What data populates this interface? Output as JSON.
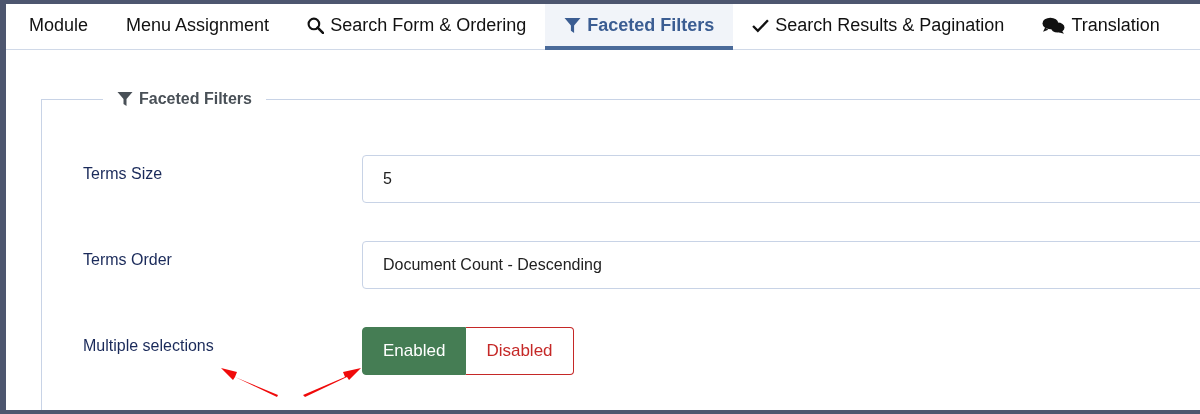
{
  "tabs": [
    {
      "label": "Module",
      "selected": false
    },
    {
      "label": "Menu Assignment",
      "selected": false
    },
    {
      "label": "Search Form & Ordering",
      "kind": "search",
      "selected": false
    },
    {
      "label": "Faceted Filters",
      "kind": "filter",
      "selected": true
    },
    {
      "label": "Search Results & Pagination",
      "kind": "check",
      "selected": false
    },
    {
      "label": "Translation",
      "kind": "chat",
      "selected": false
    }
  ],
  "fieldset": {
    "legend": "Faceted Filters",
    "fields": [
      {
        "kind": "input",
        "label": "Terms Size",
        "value": "5"
      },
      {
        "kind": "select",
        "label": "Terms Order",
        "value": "Document Count - Descending"
      },
      {
        "kind": "toggle",
        "label": "Multiple selections",
        "options": [
          {
            "label": "Enabled",
            "selected": true
          },
          {
            "label": "Disabled",
            "selected": false
          }
        ],
        "annotated": true
      }
    ]
  }
}
